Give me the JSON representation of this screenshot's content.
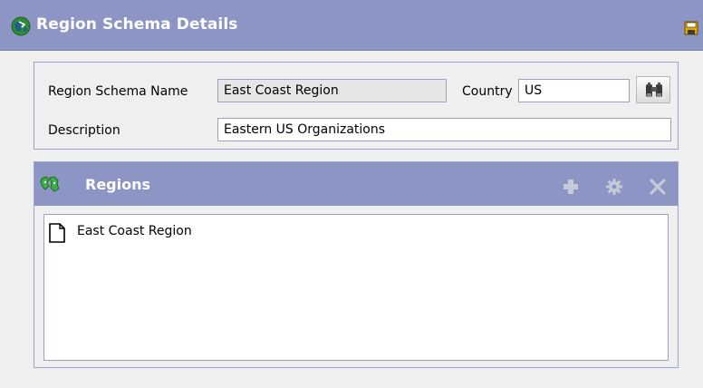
{
  "window": {
    "title": "Region Schema Details"
  },
  "details": {
    "schema_name_label": "Region Schema Name",
    "schema_name_value": "East Coast Region",
    "country_label": "Country",
    "country_value": "US",
    "description_label": "Description",
    "description_value": "Eastern US Organizations"
  },
  "regions": {
    "title": "Regions",
    "items": [
      {
        "label": "East Coast Region",
        "icon": "document-icon"
      }
    ]
  },
  "icons": {
    "title": "globe-icon",
    "save": "save-icon",
    "lookup": "binoculars-icon",
    "regions": "regions-icon",
    "add": "add-icon",
    "details": "gear-icon",
    "delete": "delete-icon"
  },
  "colors": {
    "header_bar": "#8c95c4",
    "panel_border": "#9aa3cc",
    "background": "#efefef",
    "readonly_field": "#e6e6e6",
    "disabled_tool": "#c6c9d8"
  }
}
